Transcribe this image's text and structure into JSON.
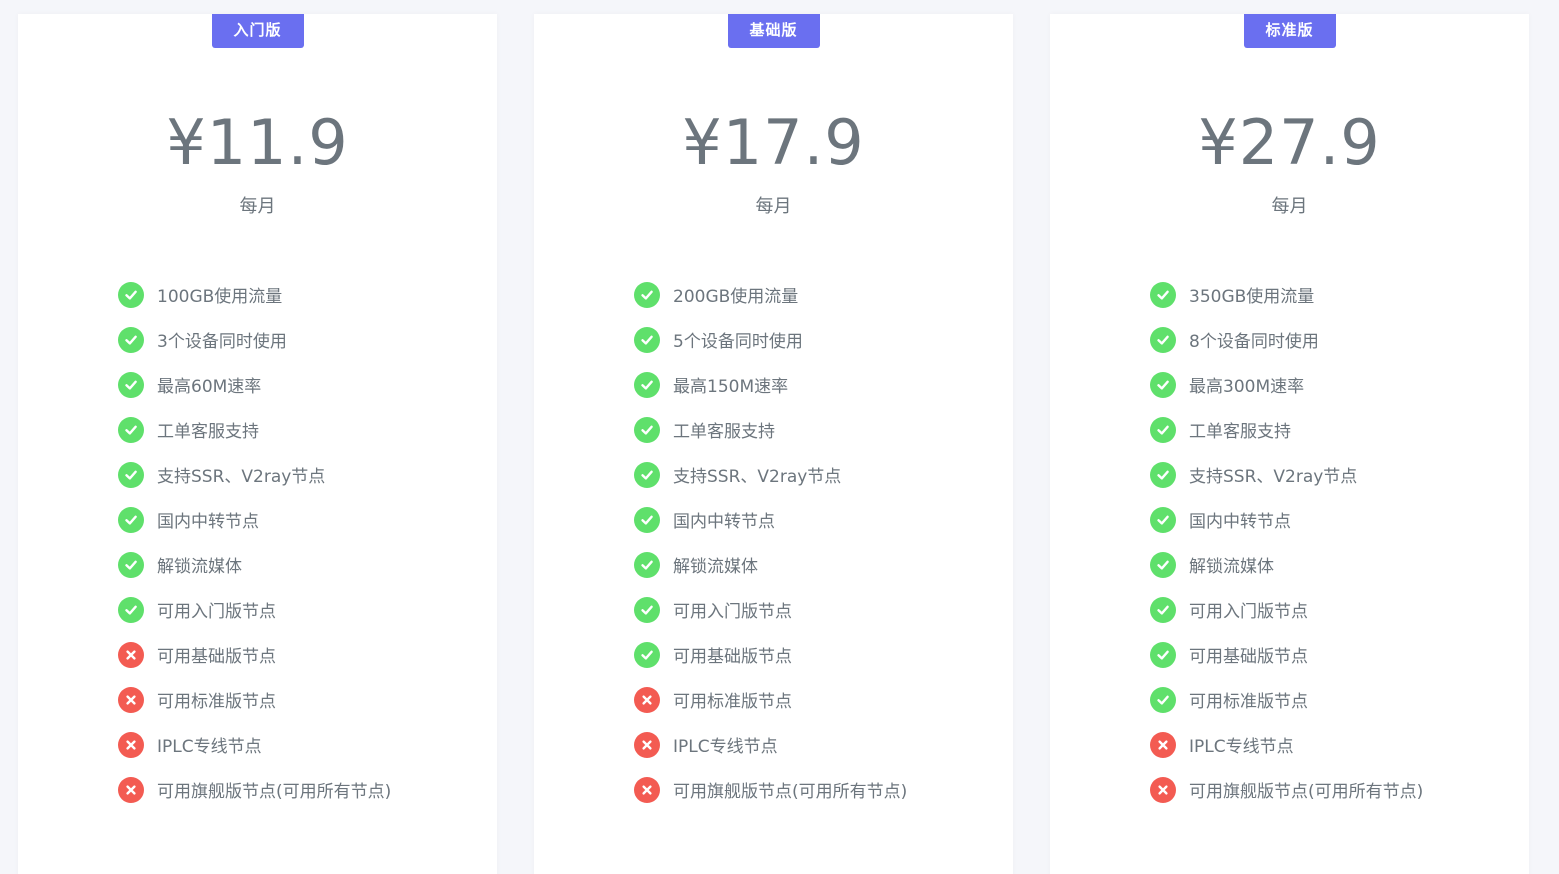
{
  "colors": {
    "badge": "#6a6ff0",
    "included": "#5fe06b",
    "excluded": "#f35b52",
    "text": "#6c757d"
  },
  "plans": [
    {
      "badge": "入门版",
      "price": "¥11.9",
      "period": "每月",
      "features": [
        {
          "label": "100GB使用流量",
          "included": true,
          "icon": "check-circle-icon"
        },
        {
          "label": "3个设备同时使用",
          "included": true,
          "icon": "check-circle-icon"
        },
        {
          "label": "最高60M速率",
          "included": true,
          "icon": "check-circle-icon"
        },
        {
          "label": "工单客服支持",
          "included": true,
          "icon": "check-circle-icon"
        },
        {
          "label": "支持SSR、V2ray节点",
          "included": true,
          "icon": "check-circle-icon"
        },
        {
          "label": "国内中转节点",
          "included": true,
          "icon": "check-circle-icon"
        },
        {
          "label": "解锁流媒体",
          "included": true,
          "icon": "check-circle-icon"
        },
        {
          "label": "可用入门版节点",
          "included": true,
          "icon": "check-circle-icon"
        },
        {
          "label": "可用基础版节点",
          "included": false,
          "icon": "x-circle-icon"
        },
        {
          "label": "可用标准版节点",
          "included": false,
          "icon": "x-circle-icon"
        },
        {
          "label": "IPLC专线节点",
          "included": false,
          "icon": "x-circle-icon"
        },
        {
          "label": "可用旗舰版节点(可用所有节点)",
          "included": false,
          "icon": "x-circle-icon"
        }
      ]
    },
    {
      "badge": "基础版",
      "price": "¥17.9",
      "period": "每月",
      "features": [
        {
          "label": "200GB使用流量",
          "included": true,
          "icon": "check-circle-icon"
        },
        {
          "label": "5个设备同时使用",
          "included": true,
          "icon": "check-circle-icon"
        },
        {
          "label": "最高150M速率",
          "included": true,
          "icon": "check-circle-icon"
        },
        {
          "label": "工单客服支持",
          "included": true,
          "icon": "check-circle-icon"
        },
        {
          "label": "支持SSR、V2ray节点",
          "included": true,
          "icon": "check-circle-icon"
        },
        {
          "label": "国内中转节点",
          "included": true,
          "icon": "check-circle-icon"
        },
        {
          "label": "解锁流媒体",
          "included": true,
          "icon": "check-circle-icon"
        },
        {
          "label": "可用入门版节点",
          "included": true,
          "icon": "check-circle-icon"
        },
        {
          "label": "可用基础版节点",
          "included": true,
          "icon": "check-circle-icon"
        },
        {
          "label": "可用标准版节点",
          "included": false,
          "icon": "x-circle-icon"
        },
        {
          "label": "IPLC专线节点",
          "included": false,
          "icon": "x-circle-icon"
        },
        {
          "label": "可用旗舰版节点(可用所有节点)",
          "included": false,
          "icon": "x-circle-icon"
        }
      ]
    },
    {
      "badge": "标准版",
      "price": "¥27.9",
      "period": "每月",
      "features": [
        {
          "label": "350GB使用流量",
          "included": true,
          "icon": "check-circle-icon"
        },
        {
          "label": "8个设备同时使用",
          "included": true,
          "icon": "check-circle-icon"
        },
        {
          "label": "最高300M速率",
          "included": true,
          "icon": "check-circle-icon"
        },
        {
          "label": "工单客服支持",
          "included": true,
          "icon": "check-circle-icon"
        },
        {
          "label": "支持SSR、V2ray节点",
          "included": true,
          "icon": "check-circle-icon"
        },
        {
          "label": "国内中转节点",
          "included": true,
          "icon": "check-circle-icon"
        },
        {
          "label": "解锁流媒体",
          "included": true,
          "icon": "check-circle-icon"
        },
        {
          "label": "可用入门版节点",
          "included": true,
          "icon": "check-circle-icon"
        },
        {
          "label": "可用基础版节点",
          "included": true,
          "icon": "check-circle-icon"
        },
        {
          "label": "可用标准版节点",
          "included": true,
          "icon": "check-circle-icon"
        },
        {
          "label": "IPLC专线节点",
          "included": false,
          "icon": "x-circle-icon"
        },
        {
          "label": "可用旗舰版节点(可用所有节点)",
          "included": false,
          "icon": "x-circle-icon"
        }
      ]
    }
  ]
}
